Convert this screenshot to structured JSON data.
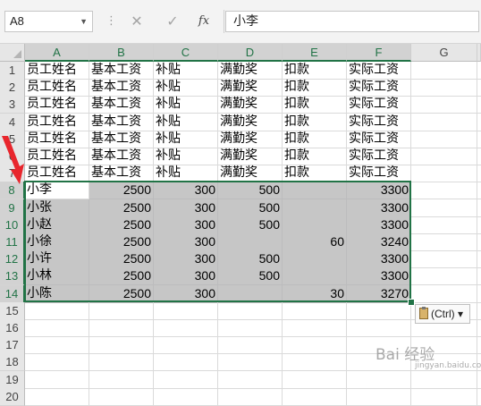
{
  "formula_bar": {
    "name_box": "A8",
    "more_icon": "⋮",
    "cancel_icon": "✕",
    "enter_icon": "✓",
    "fx_label": "fx",
    "formula_value": "小李"
  },
  "columns": [
    "A",
    "B",
    "C",
    "D",
    "E",
    "F",
    "G"
  ],
  "rows": [
    {
      "n": "1",
      "cells": [
        "员工姓名",
        "基本工资",
        "补贴",
        "满勤奖",
        "扣款",
        "实际工资",
        ""
      ]
    },
    {
      "n": "2",
      "cells": [
        "员工姓名",
        "基本工资",
        "补贴",
        "满勤奖",
        "扣款",
        "实际工资",
        ""
      ]
    },
    {
      "n": "3",
      "cells": [
        "员工姓名",
        "基本工资",
        "补贴",
        "满勤奖",
        "扣款",
        "实际工资",
        ""
      ]
    },
    {
      "n": "4",
      "cells": [
        "员工姓名",
        "基本工资",
        "补贴",
        "满勤奖",
        "扣款",
        "实际工资",
        ""
      ]
    },
    {
      "n": "5",
      "cells": [
        "员工姓名",
        "基本工资",
        "补贴",
        "满勤奖",
        "扣款",
        "实际工资",
        ""
      ]
    },
    {
      "n": "6",
      "cells": [
        "员工姓名",
        "基本工资",
        "补贴",
        "满勤奖",
        "扣款",
        "实际工资",
        ""
      ]
    },
    {
      "n": "7",
      "cells": [
        "员工姓名",
        "基本工资",
        "补贴",
        "满勤奖",
        "扣款",
        "实际工资",
        ""
      ]
    },
    {
      "n": "8",
      "cells": [
        "小李",
        "2500",
        "300",
        "500",
        "",
        "3300",
        ""
      ]
    },
    {
      "n": "9",
      "cells": [
        "小张",
        "2500",
        "300",
        "500",
        "",
        "3300",
        ""
      ]
    },
    {
      "n": "10",
      "cells": [
        "小赵",
        "2500",
        "300",
        "500",
        "",
        "3300",
        ""
      ]
    },
    {
      "n": "11",
      "cells": [
        "小徐",
        "2500",
        "300",
        "",
        "60",
        "3240",
        ""
      ]
    },
    {
      "n": "12",
      "cells": [
        "小许",
        "2500",
        "300",
        "500",
        "",
        "3300",
        ""
      ]
    },
    {
      "n": "13",
      "cells": [
        "小林",
        "2500",
        "300",
        "500",
        "",
        "3300",
        ""
      ]
    },
    {
      "n": "14",
      "cells": [
        "小陈",
        "2500",
        "300",
        "",
        "30",
        "3270",
        ""
      ]
    },
    {
      "n": "15",
      "cells": [
        "",
        "",
        "",
        "",
        "",
        "",
        ""
      ]
    },
    {
      "n": "16",
      "cells": [
        "",
        "",
        "",
        "",
        "",
        "",
        ""
      ]
    },
    {
      "n": "17",
      "cells": [
        "",
        "",
        "",
        "",
        "",
        "",
        ""
      ]
    },
    {
      "n": "18",
      "cells": [
        "",
        "",
        "",
        "",
        "",
        "",
        ""
      ]
    },
    {
      "n": "19",
      "cells": [
        "",
        "",
        "",
        "",
        "",
        "",
        ""
      ]
    },
    {
      "n": "20",
      "cells": [
        "",
        "",
        "",
        "",
        "",
        "",
        ""
      ]
    }
  ],
  "paste_options": {
    "label": "(Ctrl)",
    "icon": "clipboard-icon"
  },
  "watermark": {
    "text": "Bai 经验",
    "sub": "jingyan.baidu.com"
  },
  "colors": {
    "accent": "#217346",
    "selection_fill": "#c6c6c6",
    "arrow": "#e8262d"
  }
}
